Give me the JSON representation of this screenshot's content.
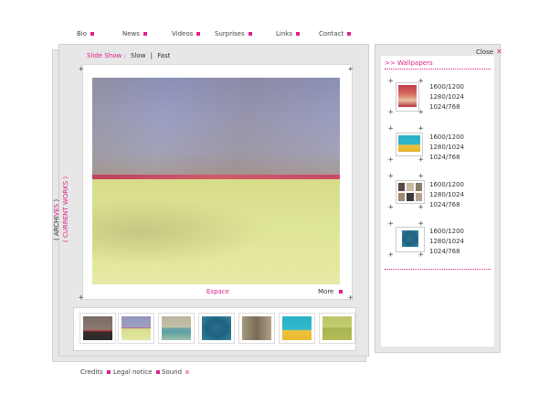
{
  "nav": {
    "items": [
      {
        "label": "Bio"
      },
      {
        "label": "News"
      },
      {
        "label": "Videos"
      },
      {
        "label": "Surprises"
      },
      {
        "label": "Links"
      },
      {
        "label": "Contact"
      }
    ]
  },
  "slideshow": {
    "label": "Slide Show",
    "separator": ":",
    "slow": "Slow",
    "divider": "|",
    "fast": "Fast"
  },
  "side_tab": {
    "archives": "( ARCHI",
    "archives_highlight": "VES",
    "archives_end": " )",
    "current": "( CURRENT WORKS )"
  },
  "artwork": {
    "title": "Espace",
    "more_label": "More"
  },
  "wallpapers": {
    "close_label": "Close",
    "title": ">> Wallpapers",
    "items": [
      {
        "res": [
          "1600/1200",
          "1280/1024",
          "1024/768"
        ]
      },
      {
        "res": [
          "1600/1200",
          "1280/1024",
          "1024/768"
        ]
      },
      {
        "res": [
          "1600/1200",
          "1280/1024",
          "1024/768"
        ]
      },
      {
        "res": [
          "1600/1200",
          "1280/1024",
          "1024/768"
        ]
      }
    ]
  },
  "footer": {
    "credits": "Credits",
    "legal": "Legal notice",
    "sound": "Sound"
  },
  "colors": {
    "accent": "#e0208a"
  }
}
